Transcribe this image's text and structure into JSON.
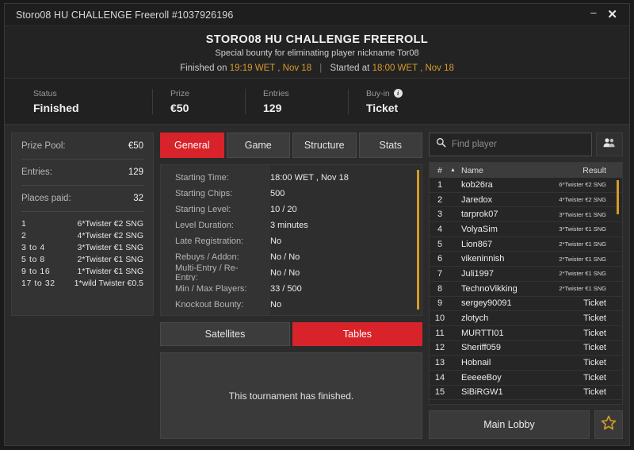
{
  "titlebar": {
    "title": "Storo08 HU CHALLENGE Freeroll #1037926196",
    "minimize": "–",
    "close": "✕"
  },
  "header": {
    "title": "STORO08 HU CHALLENGE FREEROLL",
    "subtitle": "Special bounty for eliminating player nickname Tor08",
    "finished_label": "Finished on",
    "finished_value": "19:19 WET , Nov 18",
    "separator": "|",
    "started_label": "Started at",
    "started_value": "18:00 WET , Nov 18"
  },
  "stats": [
    {
      "label": "Status",
      "value": "Finished",
      "info": ""
    },
    {
      "label": "Prize",
      "value": "€50",
      "info": ""
    },
    {
      "label": "Entries",
      "value": "129",
      "info": ""
    },
    {
      "label": "Buy-in",
      "value": "Ticket",
      "info": "i"
    }
  ],
  "prize_panel": {
    "rows": [
      {
        "key": "Prize Pool:",
        "value": "€50"
      },
      {
        "key": "Entries:",
        "value": "129"
      },
      {
        "key": "Places paid:",
        "value": "32"
      }
    ],
    "payouts": [
      {
        "place": "1",
        "prize": "6*Twister €2 SNG"
      },
      {
        "place": "2",
        "prize": "4*Twister €2 SNG"
      },
      {
        "place": "3  to  4",
        "prize": "3*Twister €1 SNG"
      },
      {
        "place": "5  to  8",
        "prize": "2*Twister €1 SNG"
      },
      {
        "place": "9  to  16",
        "prize": "1*Twister €1 SNG"
      },
      {
        "place": "17  to  32",
        "prize": "1*wild Twister €0.5"
      }
    ]
  },
  "tabs": [
    {
      "label": "General",
      "active": true
    },
    {
      "label": "Game",
      "active": false
    },
    {
      "label": "Structure",
      "active": false
    },
    {
      "label": "Stats",
      "active": false
    }
  ],
  "details": [
    {
      "key": "Starting Time:",
      "value": "18:00 WET , Nov 18"
    },
    {
      "key": "Starting Chips:",
      "value": "500"
    },
    {
      "key": "Starting Level:",
      "value": "10 / 20"
    },
    {
      "key": "Level Duration:",
      "value": "3 minutes"
    },
    {
      "key": "Late Registration:",
      "value": "No"
    },
    {
      "key": "Rebuys / Addon:",
      "value": "No / No"
    },
    {
      "key": "Multi-Entry / Re-Entry:",
      "value": "No / No"
    },
    {
      "key": "Min / Max Players:",
      "value": "33 / 500"
    },
    {
      "key": "Knockout Bounty:",
      "value": "No"
    }
  ],
  "subtabs": [
    {
      "label": "Satellites",
      "active": false
    },
    {
      "label": "Tables",
      "active": true
    }
  ],
  "empty_message": "This tournament has finished.",
  "search": {
    "placeholder": "Find player",
    "value": "",
    "icon": "search-icon",
    "players_icon": "people-icon"
  },
  "player_list": {
    "columns": {
      "num": "#",
      "sort": "▲",
      "name": "Name",
      "result": "Result"
    },
    "rows": [
      {
        "num": "1",
        "name": "kob26ra",
        "result": "6*Twister €2 SNG",
        "small": true
      },
      {
        "num": "2",
        "name": "Jaredox",
        "result": "4*Twister €2 SNG",
        "small": true
      },
      {
        "num": "3",
        "name": "tarprok07",
        "result": "3*Twister €1 SNG",
        "small": true
      },
      {
        "num": "4",
        "name": "VolyaSim",
        "result": "3*Twister €1 SNG",
        "small": true
      },
      {
        "num": "5",
        "name": "Lion867",
        "result": "2*Twister €1 SNG",
        "small": true
      },
      {
        "num": "6",
        "name": "vikeninnish",
        "result": "2*Twister €1 SNG",
        "small": true
      },
      {
        "num": "7",
        "name": "Juli1997",
        "result": "2*Twister €1 SNG",
        "small": true
      },
      {
        "num": "8",
        "name": "TechnoVikking",
        "result": "2*Twister €1 SNG",
        "small": true
      },
      {
        "num": "9",
        "name": "sergey90091",
        "result": "Ticket",
        "small": false
      },
      {
        "num": "10",
        "name": "zlotych",
        "result": "Ticket",
        "small": false
      },
      {
        "num": "11",
        "name": "MURTTI01",
        "result": "Ticket",
        "small": false
      },
      {
        "num": "12",
        "name": "Sheriff059",
        "result": "Ticket",
        "small": false
      },
      {
        "num": "13",
        "name": "Hobnail",
        "result": "Ticket",
        "small": false
      },
      {
        "num": "14",
        "name": "EeeeeBoy",
        "result": "Ticket",
        "small": false
      },
      {
        "num": "15",
        "name": "SiBiRGW1",
        "result": "Ticket",
        "small": false
      }
    ]
  },
  "footer": {
    "main_lobby": "Main Lobby",
    "favorite_icon": "star-icon"
  },
  "colors": {
    "accent_red": "#d8232a",
    "accent_gold": "#d49a28",
    "panel": "#333333",
    "background": "#2b2b2b"
  }
}
